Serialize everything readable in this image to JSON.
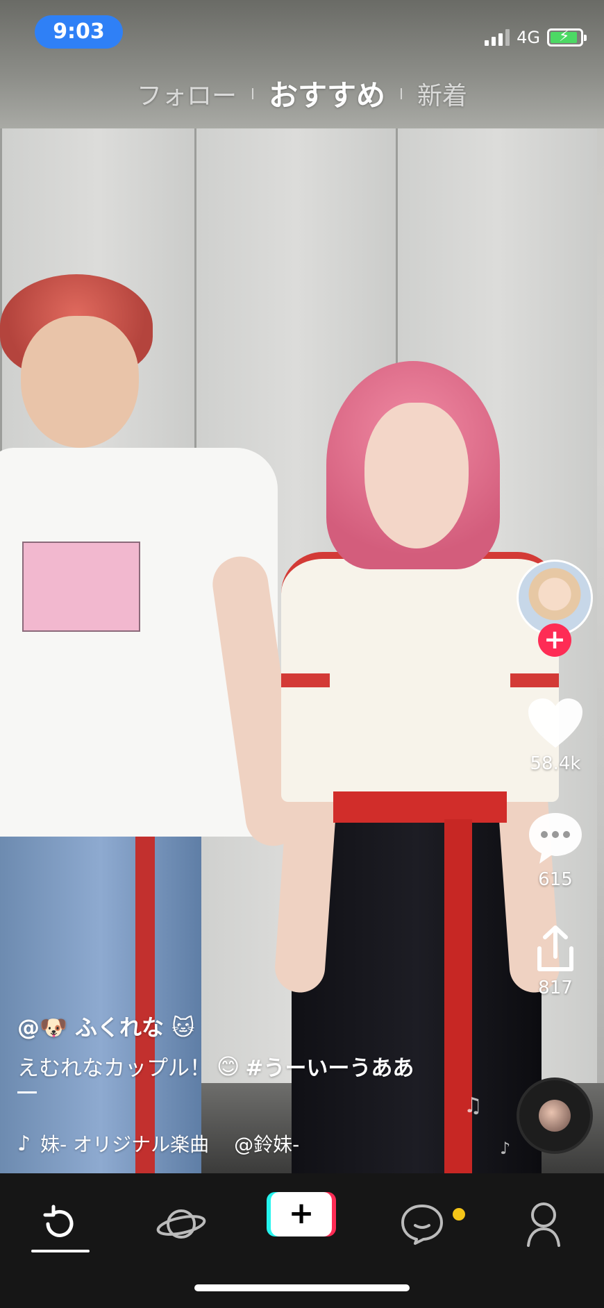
{
  "status_bar": {
    "time": "9:03",
    "network": "4G"
  },
  "top_tabs": [
    {
      "label": "フォロー",
      "active": false
    },
    {
      "label": "おすすめ",
      "active": true
    },
    {
      "label": "新着",
      "active": false
    }
  ],
  "right_rail": {
    "likes": "58.4k",
    "comments": "615",
    "shares": "817"
  },
  "caption": {
    "username": "@🐶 ふくれな 🐱",
    "description": "えむれなカップル！",
    "description_emoji": "😊",
    "hashtag": "#うーいーうああ"
  },
  "music": {
    "track": "妹- オリジナル楽曲",
    "artist": "@鈴妹-"
  },
  "bottom_nav": {
    "items": [
      "home-icon",
      "discover-icon",
      "create-icon",
      "inbox-icon",
      "profile-icon"
    ],
    "create_label": "+"
  },
  "colors": {
    "accent": "#fe2c55",
    "cyan": "#25f4ee",
    "time_pill": "#2f80f6",
    "notification_dot": "#f5c518"
  }
}
